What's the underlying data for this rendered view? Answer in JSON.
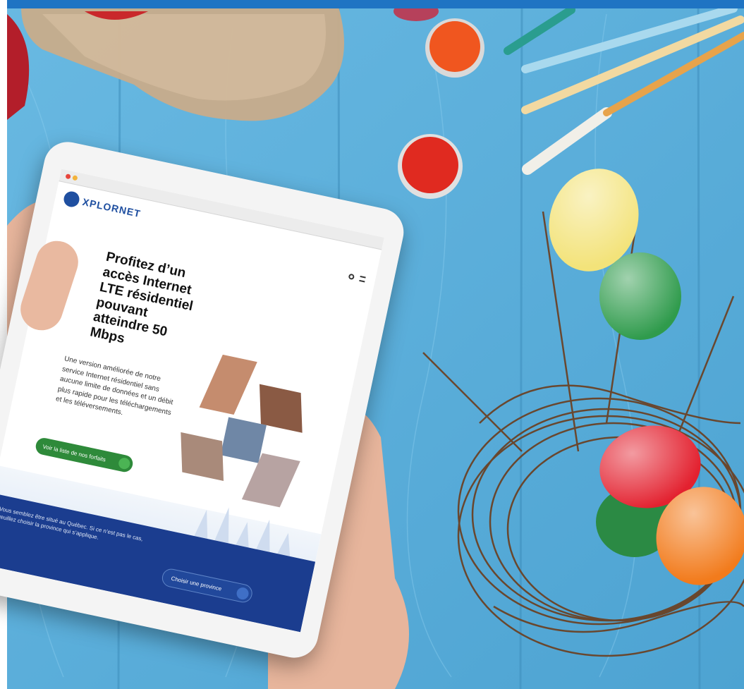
{
  "screen": {
    "brand": "XPLORNET",
    "hero_title": "Profitez d’un accès Internet LTE résidentiel pouvant atteindre 50 Mbps",
    "hero_body": "Une version améliorée de notre service Internet résidentiel sans aucune limite de données et un débit plus rapide pour les téléchargements et les téléversements.",
    "cta_label": "Voir la liste de nos forfaits",
    "footer_notice": "Vous semblez être situé au Québec. Si ce n’est pas le cas, veuillez choisir la province qui s’applique.",
    "province_button": "Choisir une province"
  },
  "colors": {
    "top_bar": "#1f74c3",
    "wood": "#5fb1dc",
    "brand_blue": "#1f4fa0",
    "cta_green": "#2e8a3a",
    "footer_navy": "#1b3d8f",
    "egg_yellow": "#f3e37a",
    "egg_green": "#2f9b4c",
    "egg_red": "#e3212f",
    "egg_orange": "#f27b1c",
    "paint_red": "#e02a20"
  }
}
